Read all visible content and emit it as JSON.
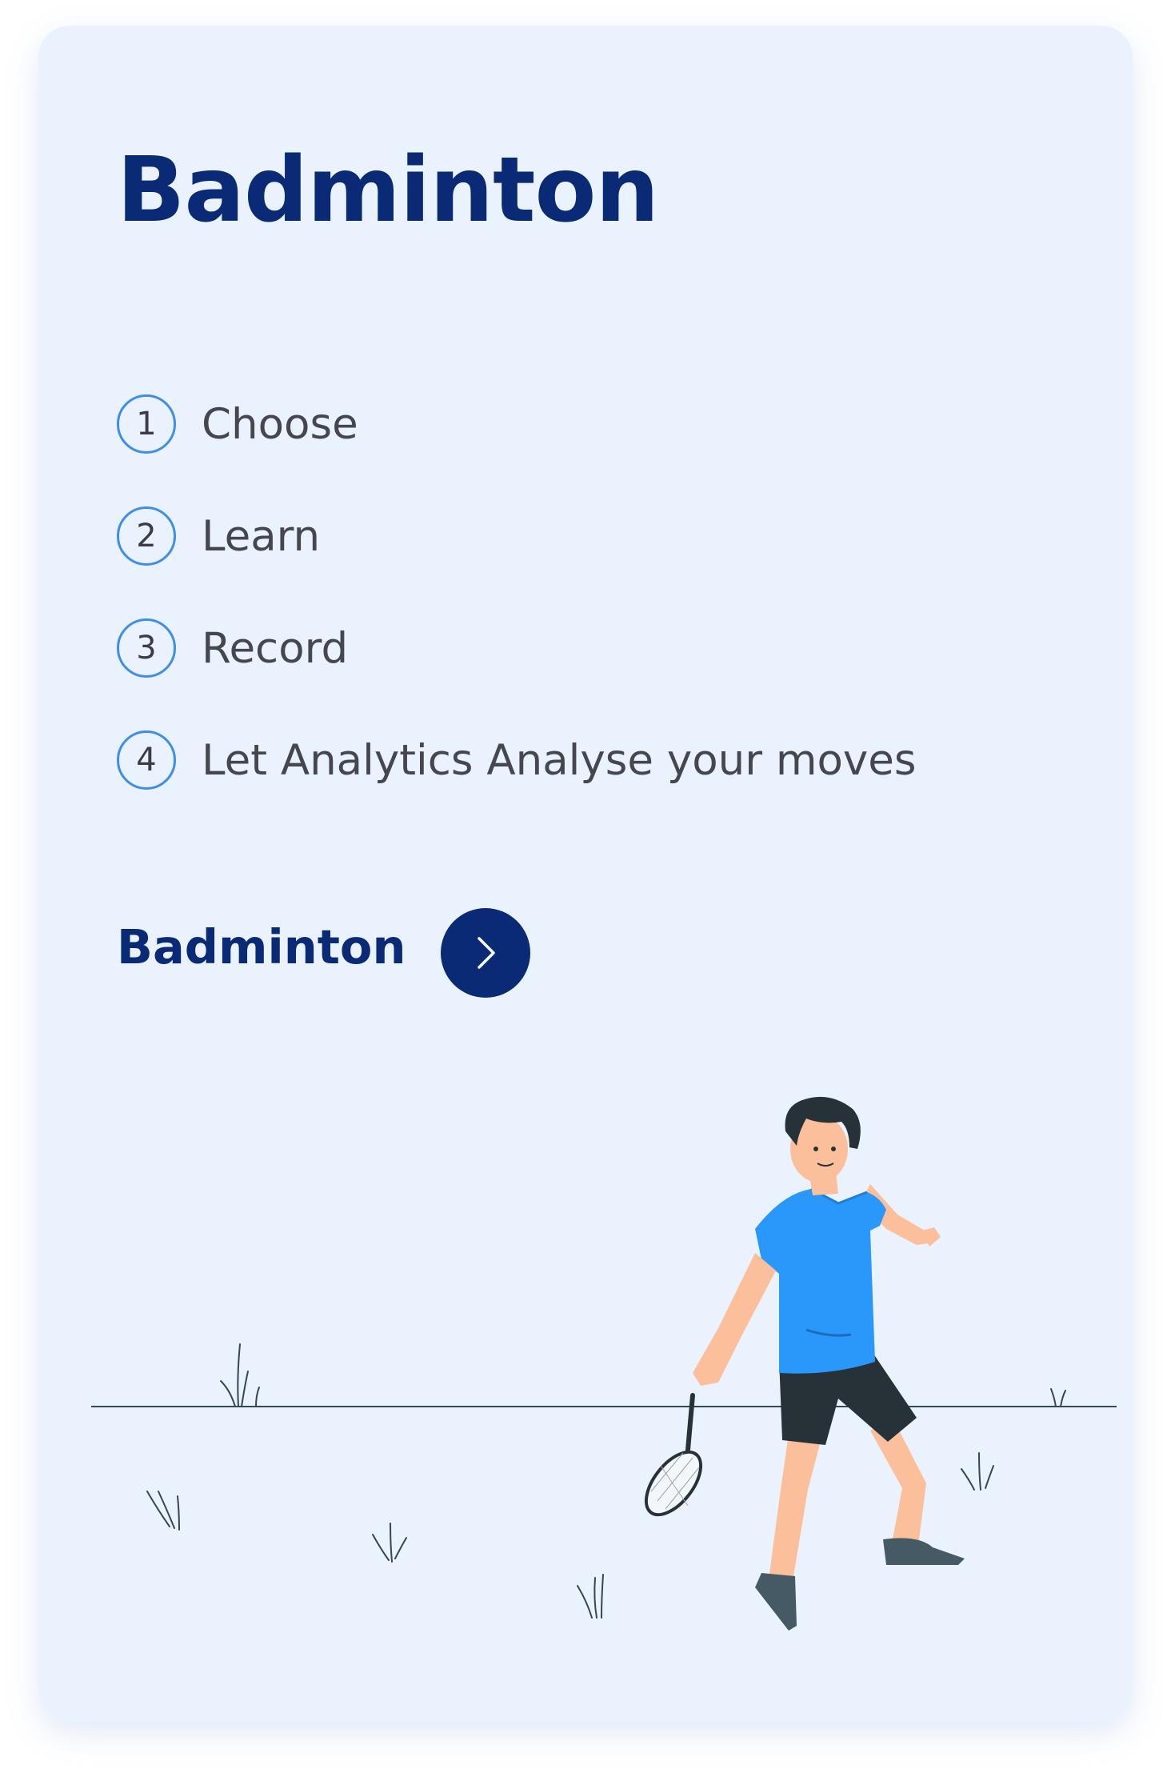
{
  "card": {
    "title": "Badminton",
    "steps": [
      {
        "number": "1",
        "label": "Choose"
      },
      {
        "number": "2",
        "label": "Learn"
      },
      {
        "number": "3",
        "label": "Record"
      },
      {
        "number": "4",
        "label": "Let Analytics Analyse your moves"
      }
    ],
    "cta": {
      "label": "Badminton",
      "button_icon": "chevron-right-icon"
    },
    "illustration": "badminton-player-illustration"
  },
  "colors": {
    "card_background": "#e9f2fd",
    "title": "#0a2a76",
    "step_ring": "#3f8fe8",
    "step_text": "#46464f",
    "cta_button": "#0a2a76",
    "shirt": "#2a97fa",
    "shorts": "#263238",
    "skin": "#fbbf9b"
  }
}
